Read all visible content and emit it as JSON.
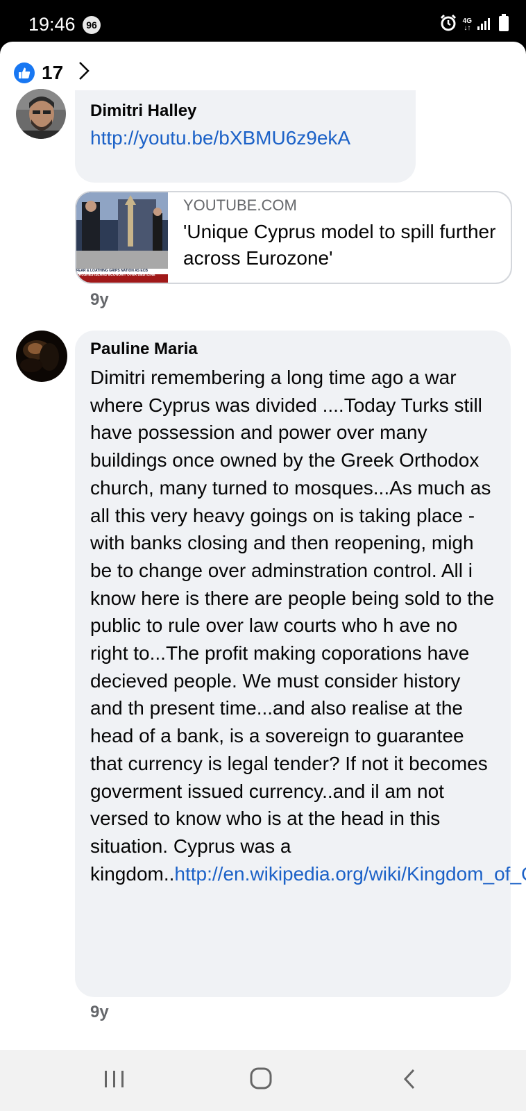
{
  "status_bar": {
    "time": "19:46",
    "notification_count": "96",
    "network": "4G"
  },
  "reactions": {
    "like_count": "17"
  },
  "comments": [
    {
      "author": "Dimitri Halley",
      "link": "http://youtu.be/bXBMU6z9ekA",
      "preview": {
        "domain": "YOUTUBE.COM",
        "title": "'Unique Cyprus model to spill further across Eurozone'",
        "thumbnail_caption_line1": "FEAR & LOATHING GRIPS NATION AS ECB",
        "thumbnail_caption_line2": "CRUSHES ISLAND ECONOMY OVER DEBTLINE"
      },
      "time_ago": "9y"
    },
    {
      "author": "Pauline Maria",
      "text": "Dimitri remembering a long time ago a war where Cyprus was divided ....Today Turks still have possession and power over many buildings once owned by the Greek Orthodox church, many turned to mosques...As much as all this very heavy goings on is taking place - with banks closing and then reopening, migh be to change over adminstration control. All i know here is there are people being sold to the public to rule over law courts who h ave no right to...The profit making coporations have decieved people. We must consider history and th present time...and also realise at the head of a bank, is a sovereign to guarantee that currency is legal tender? If not it becomes goverment issued currency..and il am not versed to know who is at the head in this situation. Cyprus was a kingdom..",
      "link": "http://en.wikipedia.org/wiki/Kingdom_of_Cyprus",
      "time_ago": "9y"
    }
  ],
  "colors": {
    "accent": "#1877f2",
    "link": "#1b61c7",
    "bubble": "#f0f2f5",
    "secondary_text": "#65676b"
  }
}
